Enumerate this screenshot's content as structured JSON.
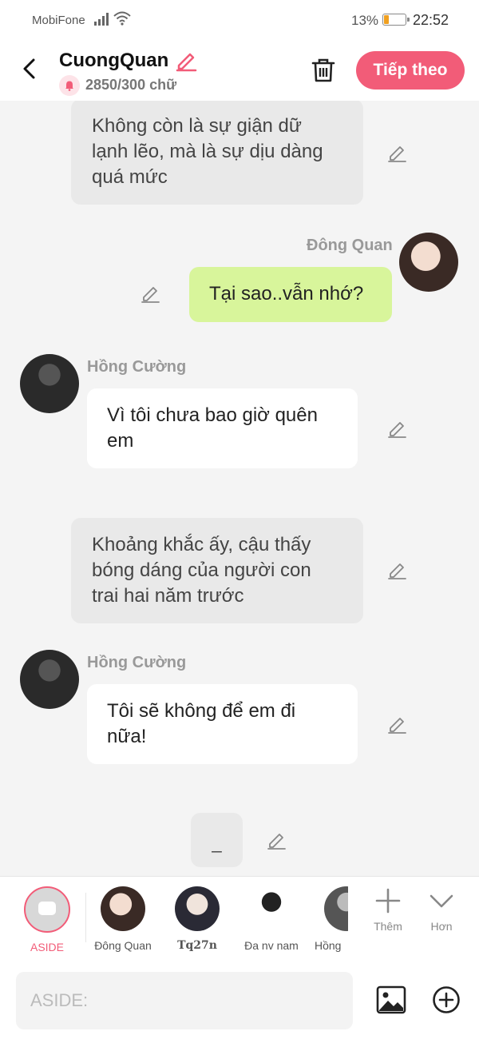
{
  "status": {
    "carrier": "MobiFone",
    "battery": "13%",
    "battery_level": 0.13,
    "time": "22:52"
  },
  "header": {
    "title": "CuongQuan",
    "word_count": "2850/300 chữ",
    "next_label": "Tiếp theo"
  },
  "messages": {
    "narration1": "Không còn là sự giận dữ lạnh lẽo, mà là sự dịu dàng quá mức",
    "sender_dong": "Đông Quan",
    "msg_dong": "Tại sao..vẫn nhớ?",
    "sender_hong1": "Hồng Cường",
    "msg_hong1": "Vì tôi chưa bao giờ quên em",
    "narration2": "Khoảng khắc ấy, cậu thấy bóng dáng của người con trai hai năm trước",
    "sender_hong2": "Hồng Cường",
    "msg_hong2": "Tôi sẽ không để em đi nữa!",
    "pending": "_"
  },
  "characters": [
    {
      "name": "ASIDE"
    },
    {
      "name": "Đông Quan"
    },
    {
      "name": "Tq27n"
    },
    {
      "name": "Đa nv nam"
    },
    {
      "name": "Hồng"
    }
  ],
  "actions": {
    "more_label": "Thêm",
    "collapse_label": "Hơn"
  },
  "input": {
    "placeholder": "ASIDE:"
  },
  "colors": {
    "accent": "#f25c78",
    "own_bubble": "#d8f59b",
    "narration": "#e9e9e9"
  }
}
